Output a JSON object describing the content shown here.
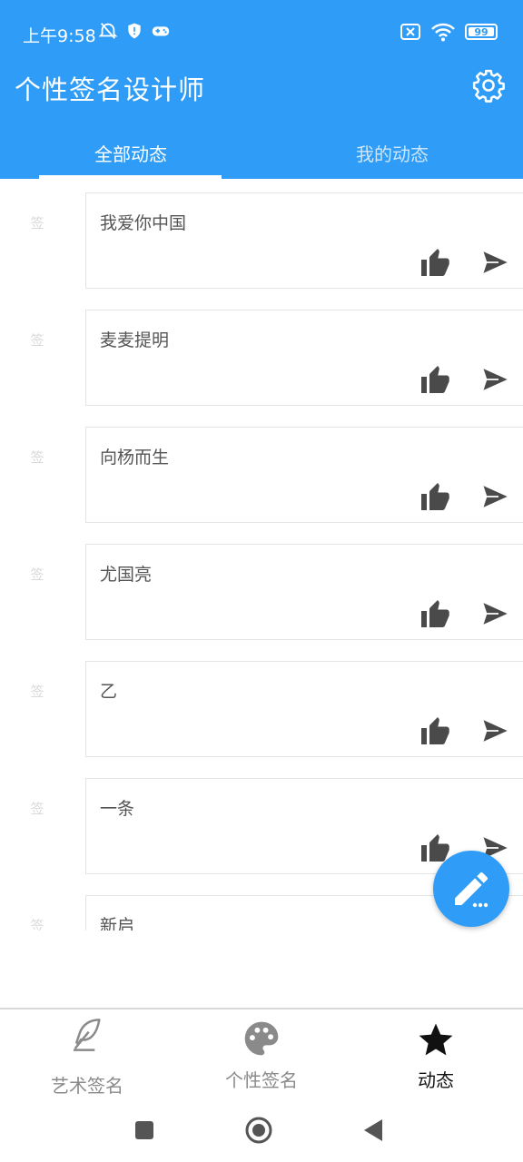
{
  "status": {
    "time": "上午9:58",
    "battery": "99"
  },
  "header": {
    "title": "个性签名设计师"
  },
  "tabs": [
    {
      "label": "全部动态",
      "active": true
    },
    {
      "label": "我的动态",
      "active": false
    }
  ],
  "feed": {
    "avatar_text": "签",
    "items": [
      {
        "text": "我爱你中国"
      },
      {
        "text": "麦麦提明"
      },
      {
        "text": "向杨而生"
      },
      {
        "text": "尤国亮"
      },
      {
        "text": "乙"
      },
      {
        "text": "一条"
      },
      {
        "text": "新启"
      }
    ]
  },
  "bottom_nav": [
    {
      "label": "艺术签名",
      "icon": "feather-icon",
      "active": false
    },
    {
      "label": "个性签名",
      "icon": "palette-icon",
      "active": false
    },
    {
      "label": "动态",
      "icon": "star-icon",
      "active": true
    }
  ],
  "colors": {
    "primary": "#2f9df7",
    "action_icon": "#4a4a4a",
    "nav_inactive": "#8a8a8a",
    "nav_active": "#111111"
  }
}
